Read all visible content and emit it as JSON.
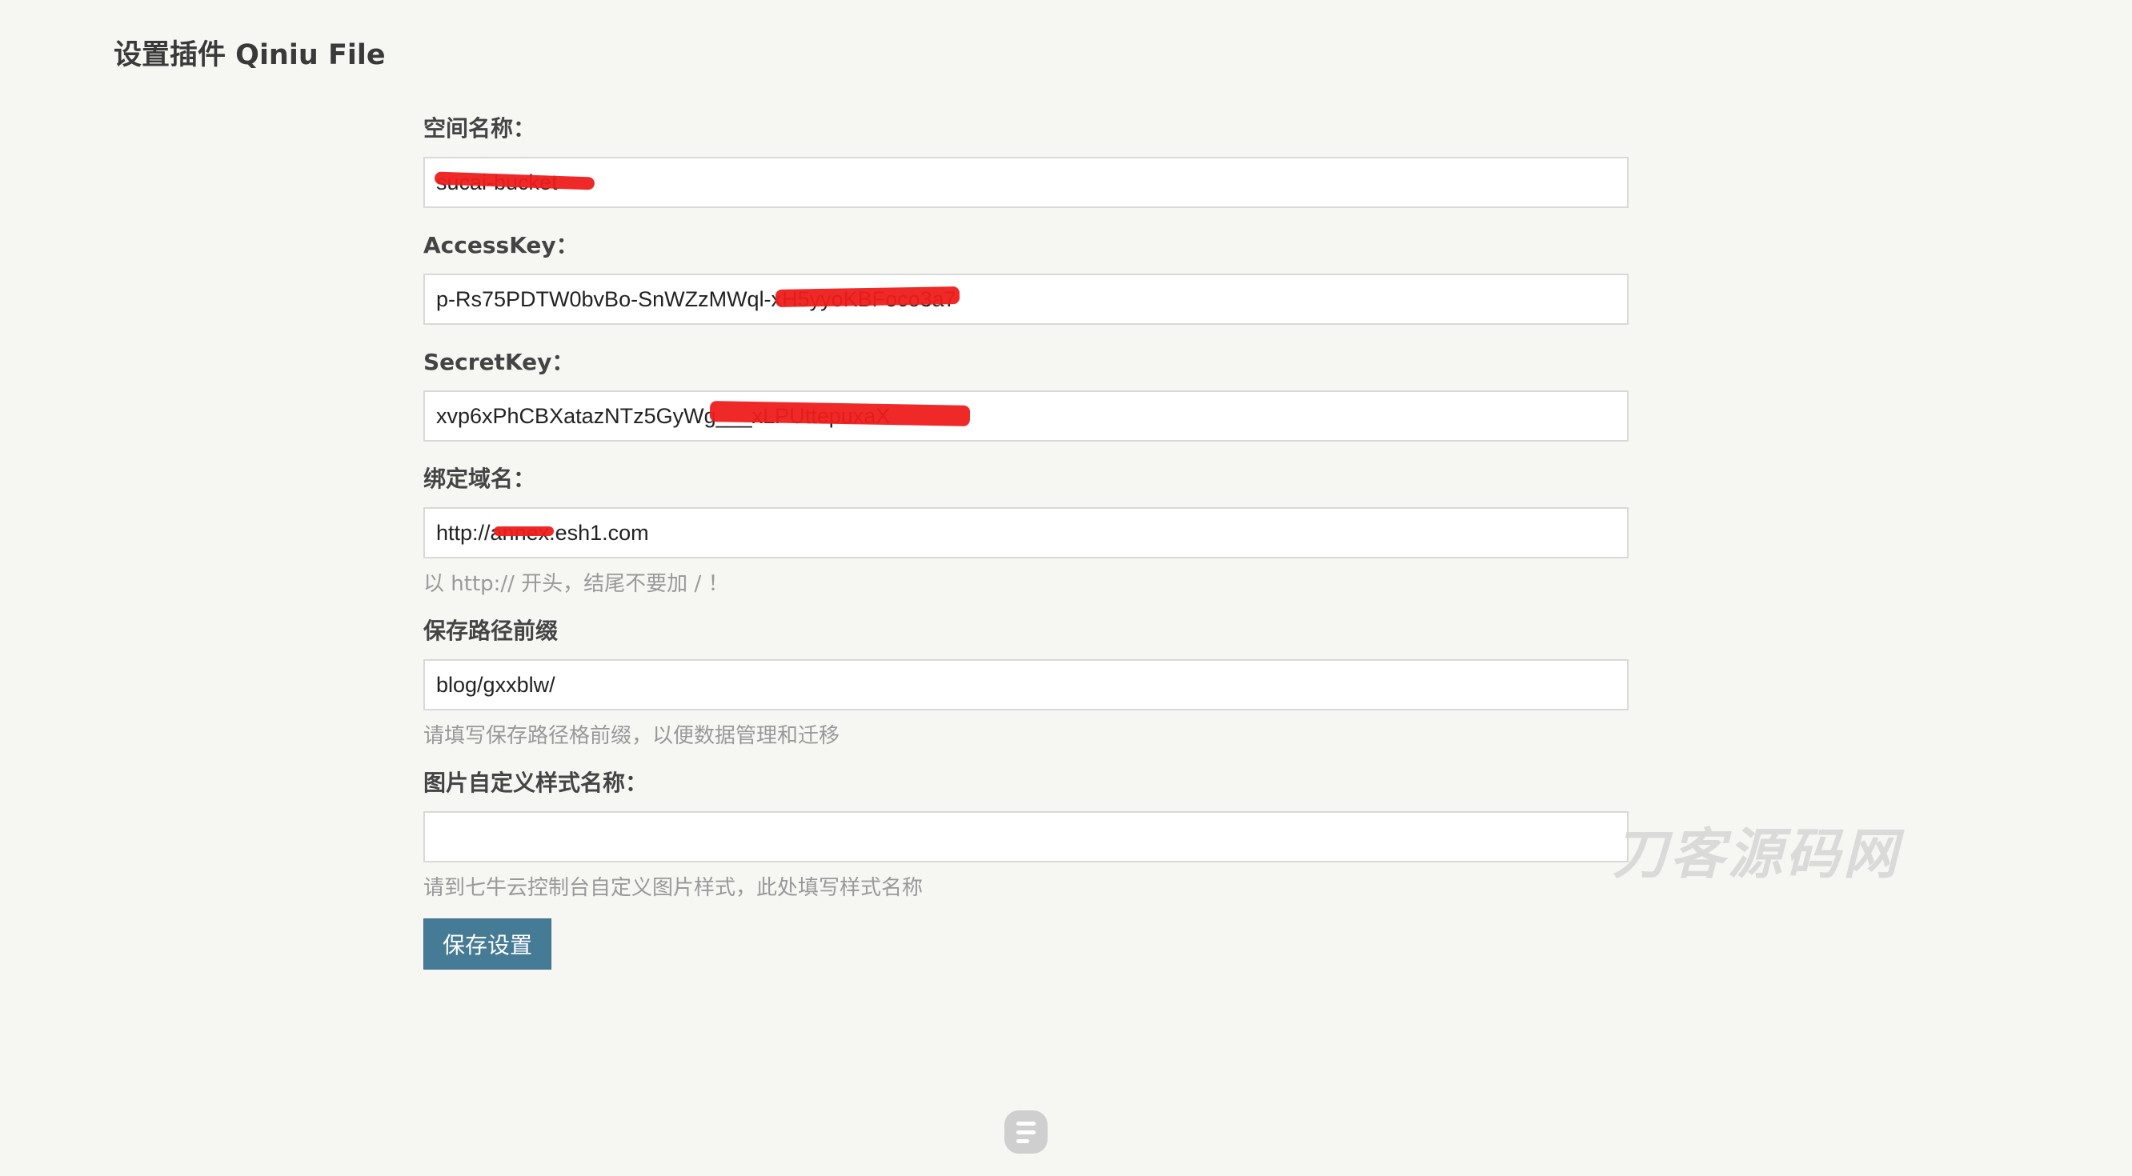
{
  "page": {
    "title": "设置插件 Qiniu File"
  },
  "form": {
    "bucket": {
      "label": "空间名称：",
      "value": "sucai-bucket"
    },
    "access_key": {
      "label": "AccessKey：",
      "value": "p-Rs75PDTW0bvBo-SnWZzMWql-xH5yyoKBFoco3a7"
    },
    "secret_key": {
      "label": "SecretKey：",
      "value": "xvp6xPhCBXatazNTz5GyWg___xLPUttepuxaX"
    },
    "domain": {
      "label": "绑定域名：",
      "value": "http://annex.esh1.com",
      "hint": "以 http:// 开头，结尾不要加 / ！"
    },
    "path_prefix": {
      "label": "保存路径前缀",
      "value": "blog/gxxblw/",
      "hint": "请填写保存路径格前缀，以便数据管理和迁移"
    },
    "image_style": {
      "label": "图片自定义样式名称：",
      "value": "",
      "hint": "请到七牛云控制台自定义图片样式，此处填写样式名称"
    },
    "save_label": "保存设置"
  },
  "watermark": {
    "text": "刀客源码网"
  },
  "colors": {
    "background": "#f6f6f3",
    "button": "#467b96",
    "redaction": "#ee1c1c",
    "hint": "#999999"
  },
  "icons": {
    "floating": "menu-lines-icon"
  }
}
